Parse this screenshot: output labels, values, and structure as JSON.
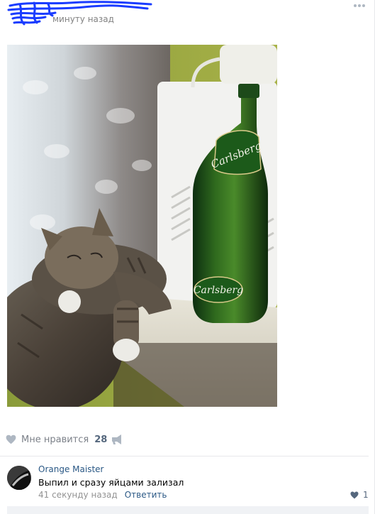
{
  "post": {
    "time": "минуту назад"
  },
  "actions": {
    "like_label": "Мне нравится",
    "like_count": "28"
  },
  "comment": {
    "author": "Orange Maister",
    "text": "Выпил и сразу яйцами зализал",
    "time": "41 секунду назад",
    "reply_label": "Ответить",
    "like_count": "1"
  },
  "photo": {
    "bottle_label": "Carlsberg"
  },
  "colors": {
    "link": "#2a5885",
    "muted": "#828282",
    "scribble": "#1a3cff"
  }
}
